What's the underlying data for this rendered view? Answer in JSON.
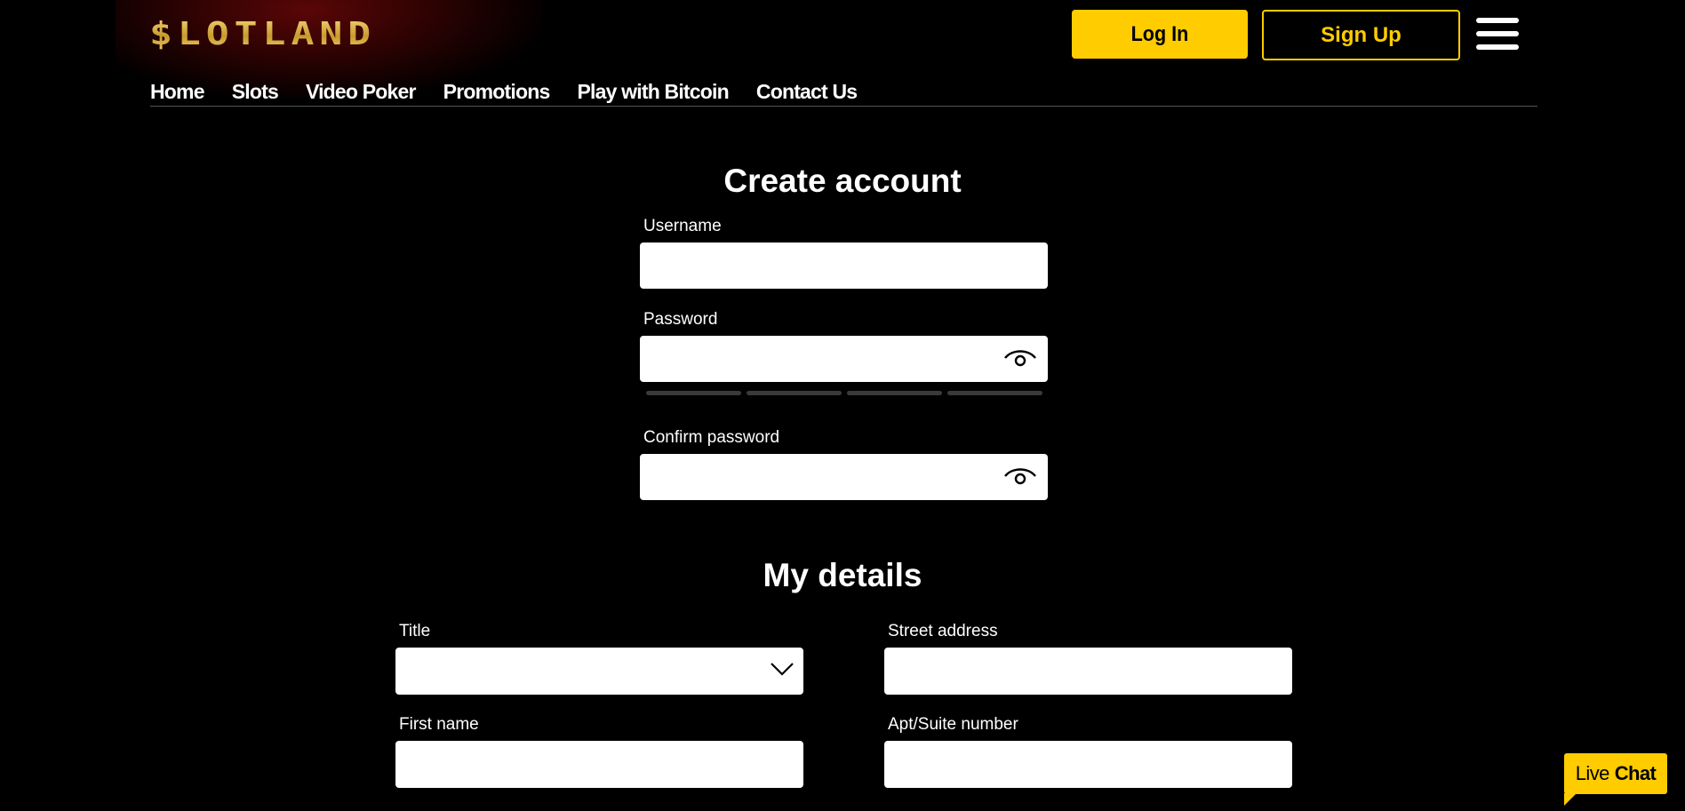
{
  "header": {
    "logo_text": "$LOTLAND",
    "login_label": "Log In",
    "signup_label": "Sign Up",
    "menu_icon": "hamburger-menu-icon"
  },
  "nav": {
    "items": [
      "Home",
      "Slots",
      "Video Poker",
      "Promotions",
      "Play with Bitcoin",
      "Contact Us"
    ]
  },
  "create_account": {
    "heading": "Create account",
    "username_label": "Username",
    "username_value": "",
    "password_label": "Password",
    "password_value": "",
    "password_toggle_icon": "eye-icon",
    "confirm_label": "Confirm password",
    "confirm_value": "",
    "confirm_toggle_icon": "eye-icon",
    "strength_segments_filled": 0,
    "strength_segments_total": 4
  },
  "my_details": {
    "heading": "My details",
    "title_label": "Title",
    "title_selected": "",
    "title_dropdown_icon": "chevron-down-icon",
    "street_label": "Street address",
    "street_value": "",
    "first_name_label": "First name",
    "first_name_value": "",
    "apt_label": "Apt/Suite number",
    "apt_value": ""
  },
  "live_chat": {
    "prefix": "Live",
    "emphasis": "Chat"
  },
  "colors": {
    "accent": "#ffcc00",
    "background": "#000000",
    "logo_gold": "#d6b04a",
    "field_bg": "#ffffff",
    "strength_track": "#3a3a3a"
  }
}
